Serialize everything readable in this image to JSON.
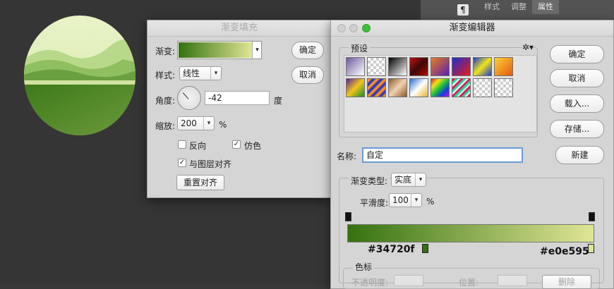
{
  "panel": {
    "tabs": [
      "样式",
      "调整",
      "属性"
    ],
    "active_tab": "属性",
    "icon": "paragraph-icon"
  },
  "gradient_fill": {
    "title": "渐变填充",
    "gradient_label": "渐变:",
    "style_label": "样式:",
    "style_value": "线性",
    "angle_label": "角度:",
    "angle_value": "-42",
    "angle_unit": "度",
    "scale_label": "缩放:",
    "scale_value": "200",
    "scale_unit": "%",
    "reverse_label": "反向",
    "reverse_checked": false,
    "dither_label": "仿色",
    "dither_checked": true,
    "align_label": "与图层对齐",
    "align_checked": true,
    "reset_label": "重置对齐",
    "ok_label": "确定",
    "cancel_label": "取消"
  },
  "gradient_editor": {
    "title": "渐变编辑器",
    "presets_label": "预设",
    "ok_label": "确定",
    "cancel_label": "取消",
    "load_label": "载入...",
    "save_label": "存储...",
    "name_label": "名称:",
    "name_value": "自定",
    "new_label": "新建",
    "type_label": "渐变类型:",
    "type_value": "实底",
    "smooth_label": "平滑度:",
    "smooth_value": "100",
    "smooth_unit": "%",
    "color_stop_left": "#34720f",
    "color_stop_right": "#e0e595",
    "stops_section_label": "色标",
    "opacity_label": "不透明度:",
    "location_label": "位置:",
    "delete_label": "删除"
  },
  "colors": {
    "gradient_start": "#34720f",
    "gradient_end": "#e0e595"
  }
}
